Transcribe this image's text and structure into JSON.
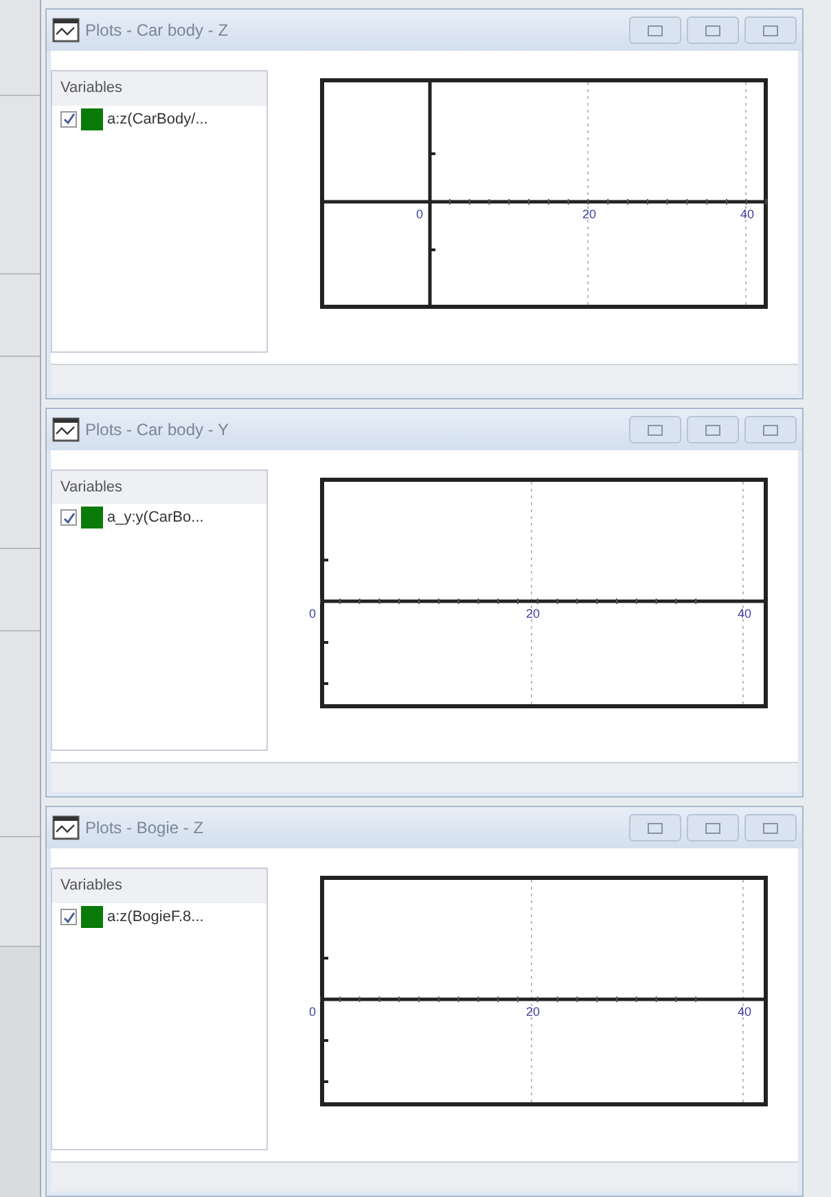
{
  "windows": [
    {
      "title": "Plots - Car body - Z",
      "variables_header": "Variables",
      "variables": [
        {
          "label": "a:z(CarBody/...",
          "checked": true,
          "color": "#0a7a0a"
        }
      ],
      "plot": {
        "tick_labels": [
          "0",
          "20",
          "40"
        ],
        "kind": "inside"
      }
    },
    {
      "title": "Plots - Car body - Y",
      "variables_header": "Variables",
      "variables": [
        {
          "label": "a_y:y(CarBo...",
          "checked": true,
          "color": "#0a7a0a"
        }
      ],
      "plot": {
        "tick_labels": [
          "0",
          "20",
          "40"
        ],
        "kind": "left"
      }
    },
    {
      "title": "Plots - Bogie - Z",
      "variables_header": "Variables",
      "variables": [
        {
          "label": "a:z(BogieF.8...",
          "checked": true,
          "color": "#0a7a0a"
        }
      ],
      "plot": {
        "tick_labels": [
          "0",
          "20",
          "40"
        ],
        "kind": "left"
      }
    }
  ]
}
